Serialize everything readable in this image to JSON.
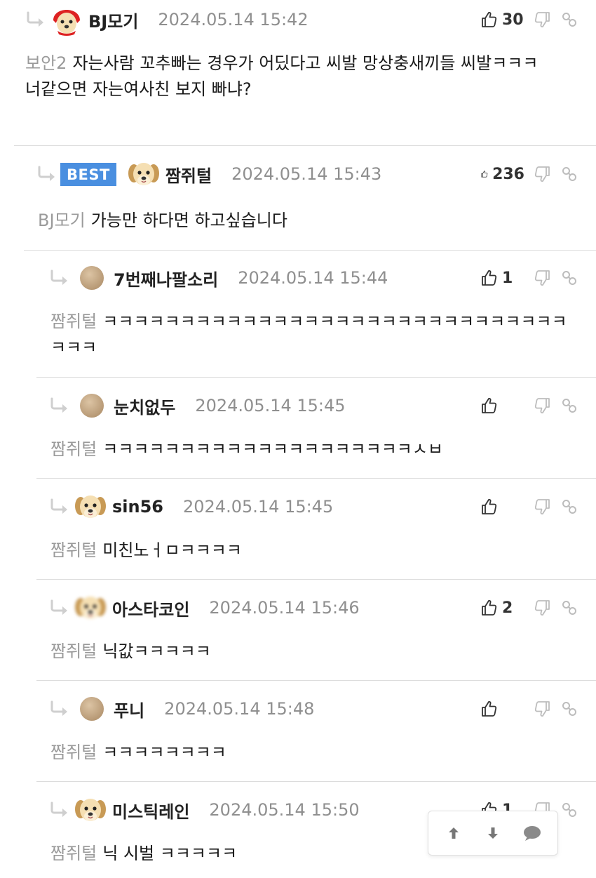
{
  "comments": [
    {
      "nick": "BJ모기",
      "date": "2024.05.14 15:42",
      "likes": "30",
      "mention": "보안2",
      "text": "자는사람 꼬추빠는 경우가 어딨다고 씨발 망상충새끼들 씨발ㅋㅋㅋ\n너같으면 자는여사친 보지 빠냐?",
      "best_label": ""
    },
    {
      "nick": "짬쥐털",
      "date": "2024.05.14 15:43",
      "likes": "236",
      "mention": "BJ모기",
      "text": "가능만 하다면 하고싶습니다",
      "best_label": "BEST"
    },
    {
      "nick": "7번째나팔소리",
      "date": "2024.05.14 15:44",
      "likes": "1",
      "mention": "짬쥐털",
      "text": "ㅋㅋㅋㅋㅋㅋㅋㅋㅋㅋㅋㅋㅋㅋㅋㅋㅋㅋㅋㅋㅋㅋㅋㅋㅋㅋㅋㅋㅋㅋㅋㅋㅋ"
    },
    {
      "nick": "눈치없두",
      "date": "2024.05.14 15:45",
      "likes": "",
      "mention": "짬쥐털",
      "text": "ㅋㅋㅋㅋㅋㅋㅋㅋㅋㅋㅋㅋㅋㅋㅋㅋㅋㅋㅋㅋㅅㅂ"
    },
    {
      "nick": "sin56",
      "date": "2024.05.14 15:45",
      "likes": "",
      "mention": "짬쥐털",
      "text": "미친노ㅓㅁㅋㅋㅋㅋ"
    },
    {
      "nick": "아스타코인",
      "date": "2024.05.14 15:46",
      "likes": "2",
      "mention": "짬쥐털",
      "text": "닉값ㅋㅋㅋㅋㅋ"
    },
    {
      "nick": "푸니",
      "date": "2024.05.14 15:48",
      "likes": "",
      "mention": "짬쥐털",
      "text": "ㅋㅋㅋㅋㅋㅋㅋㅋ"
    },
    {
      "nick": "미스틱레인",
      "date": "2024.05.14 15:50",
      "likes": "1",
      "mention": "짬쥐털",
      "text": "닉 시벌 ㅋㅋㅋㅋㅋ"
    }
  ],
  "icons": {
    "reply": "reply-arrow-icon",
    "like": "thumbs-up-icon",
    "dislike": "thumbs-down-icon",
    "link": "link-icon",
    "scroll_up": "arrow-up-icon",
    "scroll_down": "arrow-down-icon",
    "comment": "speech-bubble-icon"
  },
  "colors": {
    "best_badge": "#4a8fe0",
    "mention": "#9a9a9a",
    "date": "#8f8f8f",
    "divider": "#dcdcdc"
  }
}
